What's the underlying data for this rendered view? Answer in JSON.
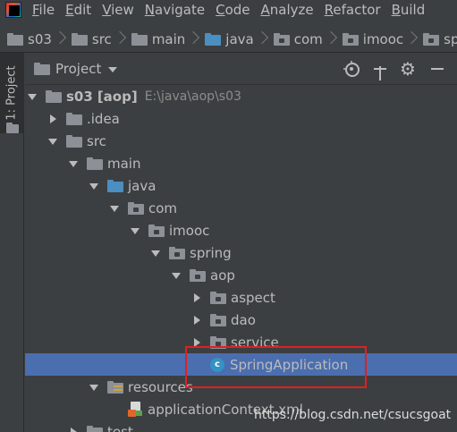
{
  "menu": [
    "File",
    "Edit",
    "View",
    "Navigate",
    "Code",
    "Analyze",
    "Refactor",
    "Build"
  ],
  "breadcrumb": [
    "s03",
    "src",
    "main",
    "java",
    "com",
    "imooc",
    "spring"
  ],
  "side_tab": {
    "label": "1: Project"
  },
  "panel": {
    "title": "Project"
  },
  "tree": [
    {
      "label": "s03",
      "suffix": "[aop]",
      "path": "E:\\java\\aop\\s03",
      "depth": 0,
      "arrow": "down",
      "icon": "module-folder-icon"
    },
    {
      "label": ".idea",
      "depth": 1,
      "arrow": "right",
      "icon": "folder-icon"
    },
    {
      "label": "src",
      "depth": 1,
      "arrow": "down",
      "icon": "folder-icon"
    },
    {
      "label": "main",
      "depth": 2,
      "arrow": "down",
      "icon": "folder-icon"
    },
    {
      "label": "java",
      "depth": 3,
      "arrow": "down",
      "icon": "source-folder-icon"
    },
    {
      "label": "com",
      "depth": 4,
      "arrow": "down",
      "icon": "package-icon"
    },
    {
      "label": "imooc",
      "depth": 5,
      "arrow": "down",
      "icon": "package-icon"
    },
    {
      "label": "spring",
      "depth": 6,
      "arrow": "down",
      "icon": "package-icon"
    },
    {
      "label": "aop",
      "depth": 7,
      "arrow": "down",
      "icon": "package-icon"
    },
    {
      "label": "aspect",
      "depth": 8,
      "arrow": "right",
      "icon": "package-icon"
    },
    {
      "label": "dao",
      "depth": 8,
      "arrow": "right",
      "icon": "package-icon"
    },
    {
      "label": "service",
      "depth": 8,
      "arrow": "right",
      "icon": "package-icon"
    },
    {
      "label": "SpringApplication",
      "depth": 8,
      "arrow": "none",
      "icon": "java-class-icon",
      "selected": true
    },
    {
      "label": "resources",
      "depth": 3,
      "arrow": "down",
      "icon": "resources-folder-icon"
    },
    {
      "label": "applicationContext.xml",
      "depth": 4,
      "arrow": "none",
      "icon": "xml-file-icon"
    },
    {
      "label": "test",
      "depth": 2,
      "arrow": "right",
      "icon": "folder-icon"
    }
  ],
  "watermark": "https://blog.csdn.net/csucsgoat",
  "colors": {
    "background": "#3c3f41",
    "selection": "#4b6eaf",
    "highlight_box": "#e02020",
    "text": "#bbbbbb"
  }
}
